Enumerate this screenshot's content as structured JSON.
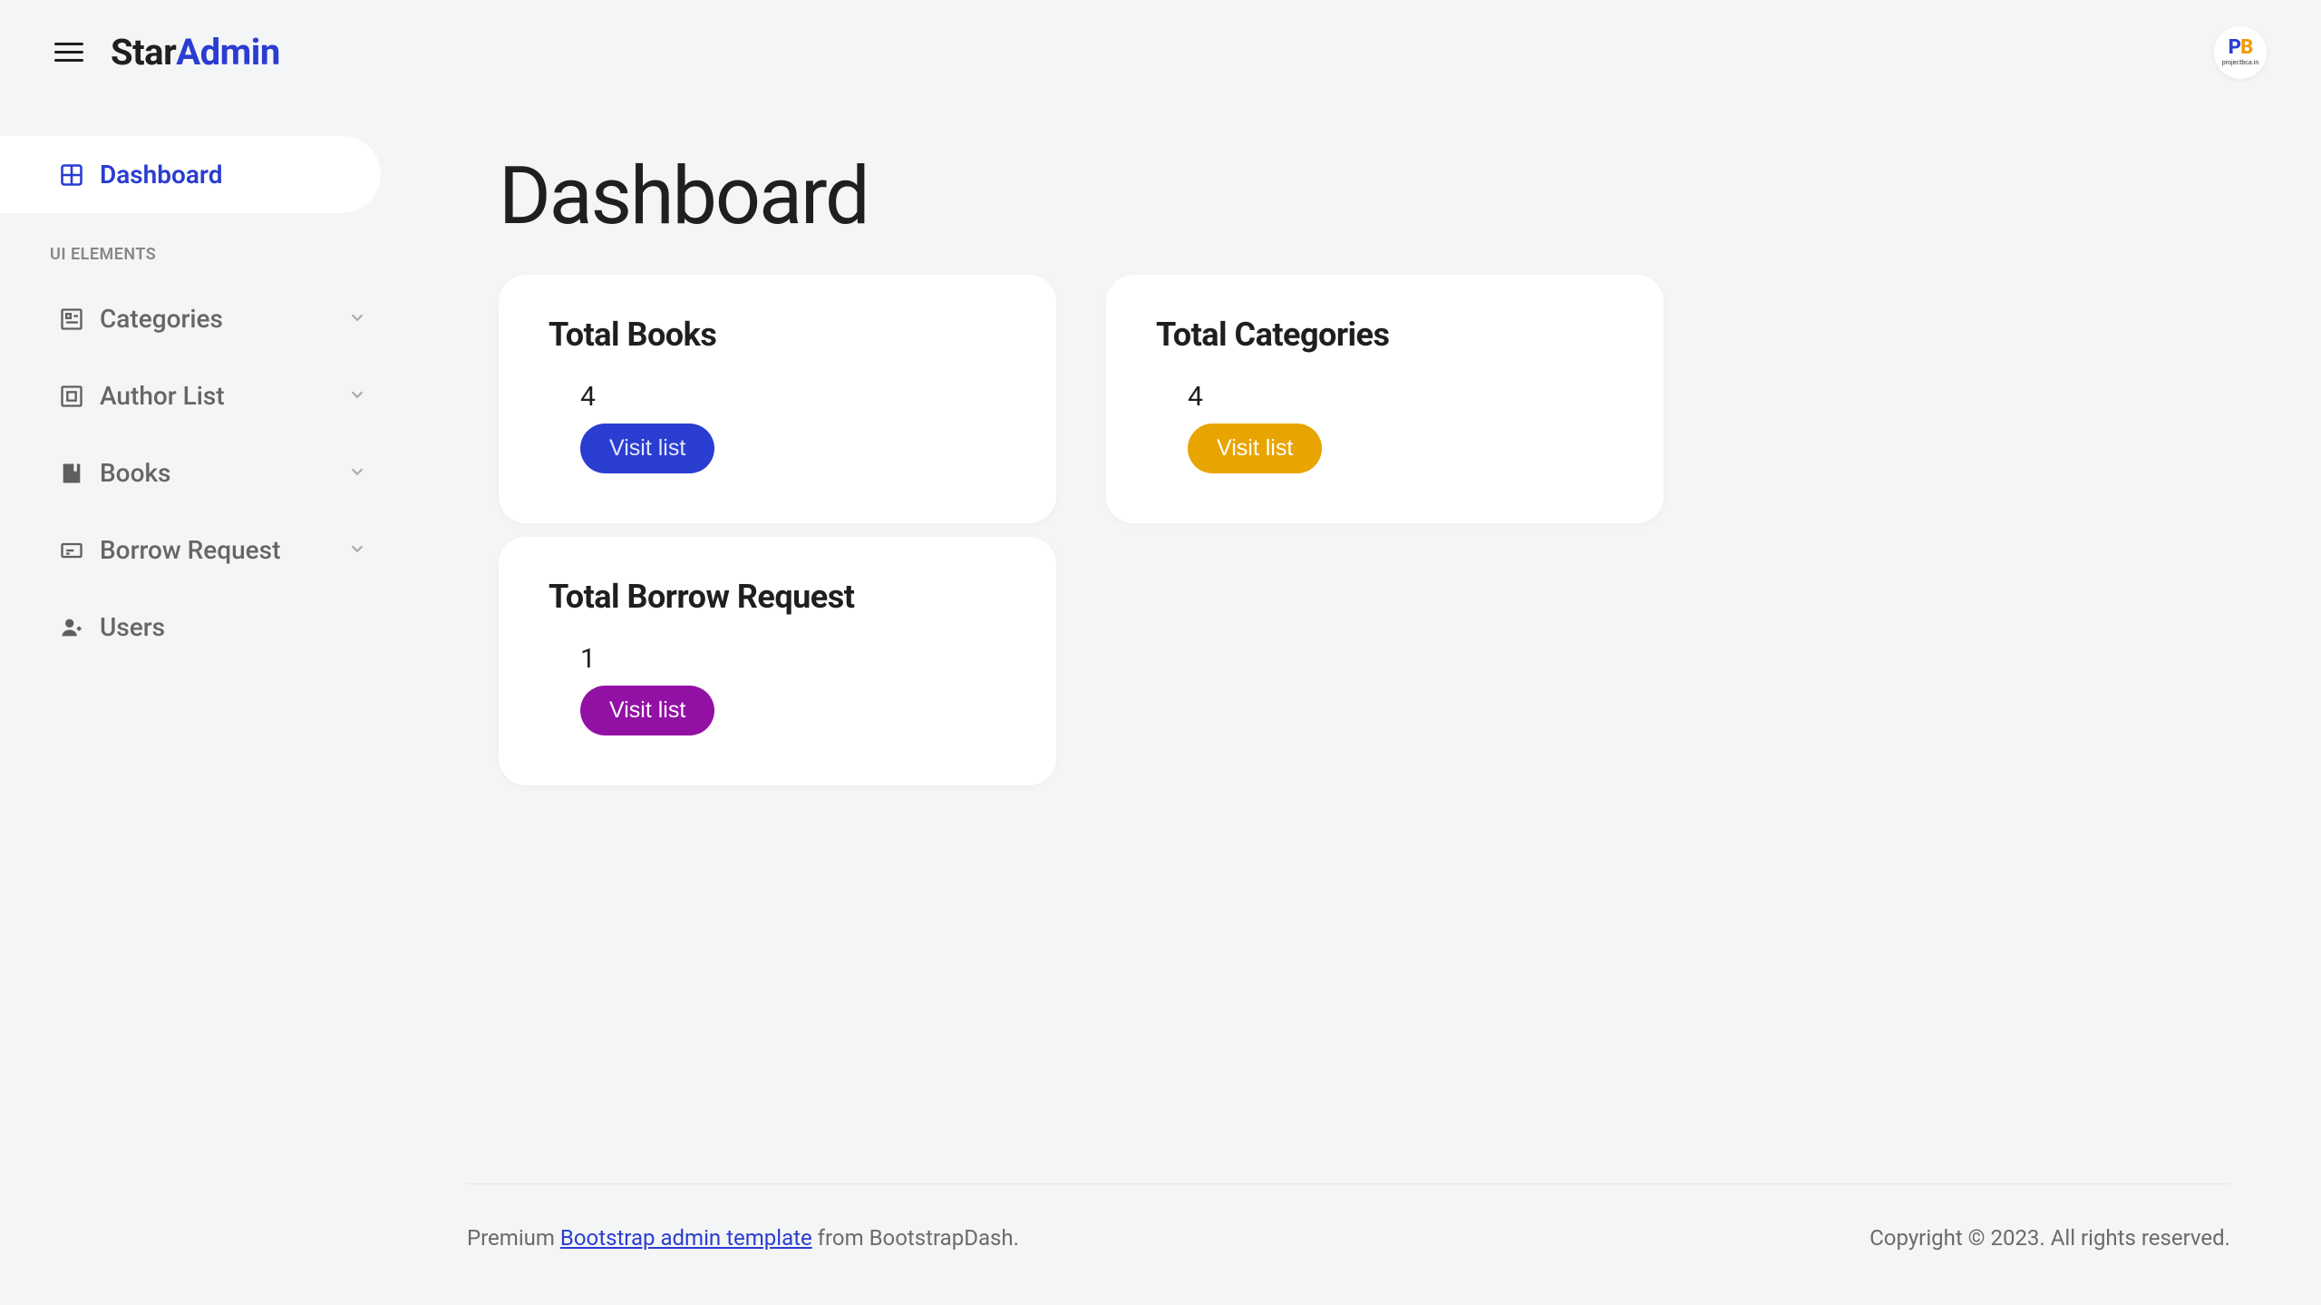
{
  "brand": {
    "part1": "Star",
    "part2": "Admin"
  },
  "avatar": {
    "initials_p": "P",
    "initials_b": "B",
    "subtitle": "projectbca.in"
  },
  "sidebar": {
    "dashboard": "Dashboard",
    "section_title": "UI ELEMENTS",
    "items": {
      "categories": "Categories",
      "author_list": "Author List",
      "books": "Books",
      "borrow_request": "Borrow Request",
      "users": "Users"
    }
  },
  "page": {
    "title": "Dashboard"
  },
  "cards": {
    "total_books": {
      "title": "Total Books",
      "value": "4",
      "button": "Visit list",
      "button_color": "#2a3dd1"
    },
    "total_categories": {
      "title": "Total Categories",
      "value": "4",
      "button": "Visit list",
      "button_color": "#e8a400"
    },
    "total_borrow": {
      "title": "Total Borrow Request",
      "value": "1",
      "button": "Visit list",
      "button_color": "#9310a5"
    }
  },
  "footer": {
    "prefix": "Premium ",
    "link": "Bootstrap admin template",
    "suffix": " from BootstrapDash.",
    "copyright": "Copyright © 2023. All rights reserved."
  }
}
